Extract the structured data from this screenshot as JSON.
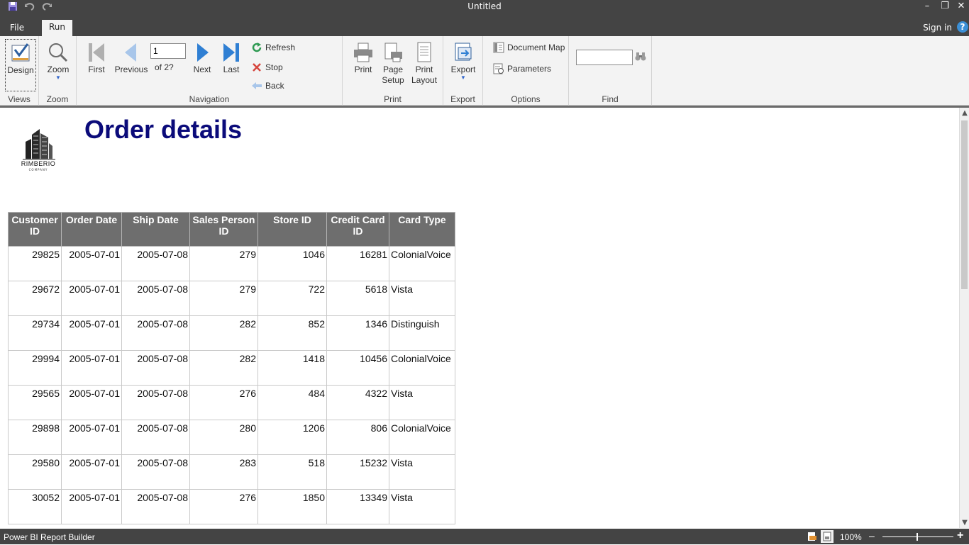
{
  "window": {
    "title": "Untitled"
  },
  "tabs": [
    {
      "label": "File",
      "active": false
    },
    {
      "label": "Run",
      "active": true
    }
  ],
  "account": {
    "sign_in": "Sign in",
    "help": "?"
  },
  "ribbon": {
    "views": {
      "label": "Views",
      "design": "Design"
    },
    "zoom": {
      "label": "Zoom",
      "zoom": "Zoom"
    },
    "navigation": {
      "label": "Navigation",
      "first": "First",
      "previous": "Previous",
      "page_value": "1",
      "of_pages": "of 2?",
      "next": "Next",
      "last": "Last",
      "refresh": "Refresh",
      "stop": "Stop",
      "back": "Back"
    },
    "print": {
      "label": "Print",
      "print": "Print",
      "page_setup_1": "Page",
      "page_setup_2": "Setup",
      "print_layout_1": "Print",
      "print_layout_2": "Layout"
    },
    "export": {
      "label": "Export",
      "export": "Export"
    },
    "options": {
      "label": "Options",
      "document_map": "Document Map",
      "parameters": "Parameters"
    },
    "find": {
      "label": "Find",
      "value": ""
    }
  },
  "report": {
    "title": "Order details",
    "logo_text": "RIMBERIO",
    "logo_subtext": "COMPANY",
    "columns": [
      "Customer ID",
      "Order Date",
      "Ship Date",
      "Sales Person ID",
      "Store ID",
      "Credit Card ID",
      "Card Type"
    ],
    "rows": [
      [
        "29825",
        "2005-07-01",
        "2005-07-08",
        "279",
        "1046",
        "16281",
        "ColonialVoice"
      ],
      [
        "29672",
        "2005-07-01",
        "2005-07-08",
        "279",
        "722",
        "5618",
        "Vista"
      ],
      [
        "29734",
        "2005-07-01",
        "2005-07-08",
        "282",
        "852",
        "1346",
        "Distinguish"
      ],
      [
        "29994",
        "2005-07-01",
        "2005-07-08",
        "282",
        "1418",
        "10456",
        "ColonialVoice"
      ],
      [
        "29565",
        "2005-07-01",
        "2005-07-08",
        "276",
        "484",
        "4322",
        "Vista"
      ],
      [
        "29898",
        "2005-07-01",
        "2005-07-08",
        "280",
        "1206",
        "806",
        "ColonialVoice"
      ],
      [
        "29580",
        "2005-07-01",
        "2005-07-08",
        "283",
        "518",
        "15232",
        "Vista"
      ],
      [
        "30052",
        "2005-07-01",
        "2005-07-08",
        "276",
        "1850",
        "13349",
        "Vista"
      ]
    ]
  },
  "status": {
    "app_name": "Power BI Report Builder",
    "zoom": "100%"
  }
}
